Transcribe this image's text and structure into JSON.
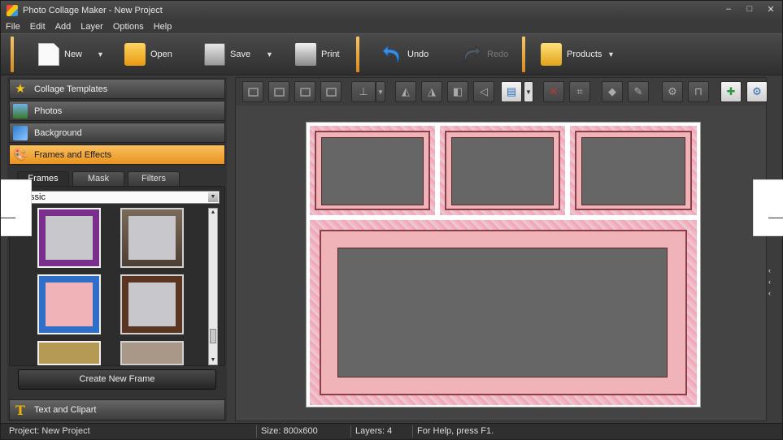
{
  "window": {
    "title": "Photo Collage Maker - New Project",
    "controls": [
      "–",
      "□",
      "✕"
    ]
  },
  "menu": [
    "File",
    "Edit",
    "Add",
    "Layer",
    "Options",
    "Help"
  ],
  "toolbar": {
    "new": "New",
    "open": "Open",
    "save": "Save",
    "print": "Print",
    "undo": "Undo",
    "redo": "Redo",
    "products": "Products"
  },
  "left_panel": {
    "items": [
      "Collage Templates",
      "Photos",
      "Background",
      "Frames and Effects"
    ],
    "active": "Frames and Effects",
    "tabs": [
      "Frames",
      "Mask",
      "Filters"
    ],
    "active_tab": "Frames",
    "frame_category": "ssic",
    "create_frame": "Create New Frame",
    "bottom_item": "Text and Clipart"
  },
  "status": {
    "project": "Project: New Project",
    "size": "Size: 800x600",
    "layers": "Layers: 4",
    "help": "For Help, press F1."
  },
  "colors": {
    "accent": "#f0a234",
    "panel": "#3c3c3c",
    "frame_pink": "#f0b4b8"
  }
}
